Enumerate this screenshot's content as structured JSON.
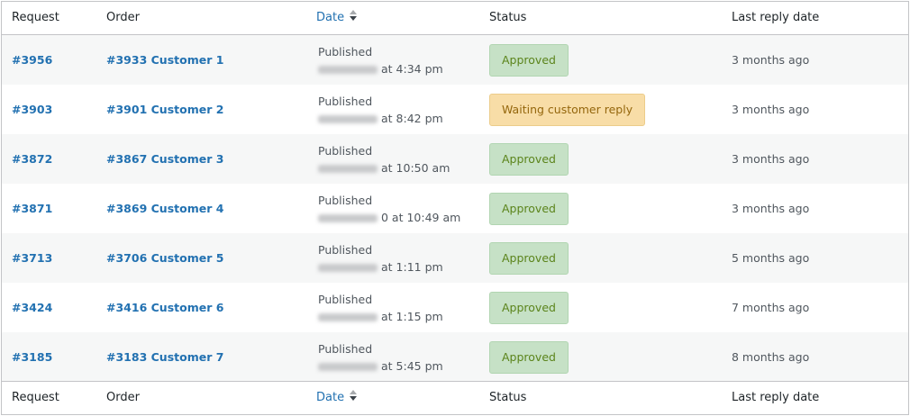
{
  "columns": {
    "request": "Request",
    "order": "Order",
    "date": "Date",
    "status": "Status",
    "last_reply": "Last reply date"
  },
  "rows": [
    {
      "request": "#3956",
      "order": "#3933 Customer 1",
      "date_label": "Published",
      "time": "at 4:34 pm",
      "status": "Approved",
      "status_kind": "approved",
      "last_reply": "3 months ago"
    },
    {
      "request": "#3903",
      "order": "#3901 Customer 2",
      "date_label": "Published",
      "time": "at 8:42 pm",
      "status": "Waiting customer reply",
      "status_kind": "waiting",
      "last_reply": "3 months ago"
    },
    {
      "request": "#3872",
      "order": "#3867 Customer 3",
      "date_label": "Published",
      "time": "at 10:50 am",
      "status": "Approved",
      "status_kind": "approved",
      "last_reply": "3 months ago"
    },
    {
      "request": "#3871",
      "order": "#3869 Customer 4",
      "date_label": "Published",
      "time": "0 at 10:49 am",
      "status": "Approved",
      "status_kind": "approved",
      "last_reply": "3 months ago"
    },
    {
      "request": "#3713",
      "order": "#3706 Customer 5",
      "date_label": "Published",
      "time": "at 1:11 pm",
      "status": "Approved",
      "status_kind": "approved",
      "last_reply": "5 months ago"
    },
    {
      "request": "#3424",
      "order": "#3416 Customer 6",
      "date_label": "Published",
      "time": "at 1:15 pm",
      "status": "Approved",
      "status_kind": "approved",
      "last_reply": "7 months ago"
    },
    {
      "request": "#3185",
      "order": "#3183 Customer 7",
      "date_label": "Published",
      "time": "at 5:45 pm",
      "status": "Approved",
      "status_kind": "approved",
      "last_reply": "8 months ago"
    }
  ],
  "colors": {
    "link": "#2271b1",
    "approved_bg": "#c6e1c6",
    "approved_text": "#5b841b",
    "waiting_bg": "#f8dda7",
    "waiting_text": "#94660c"
  }
}
